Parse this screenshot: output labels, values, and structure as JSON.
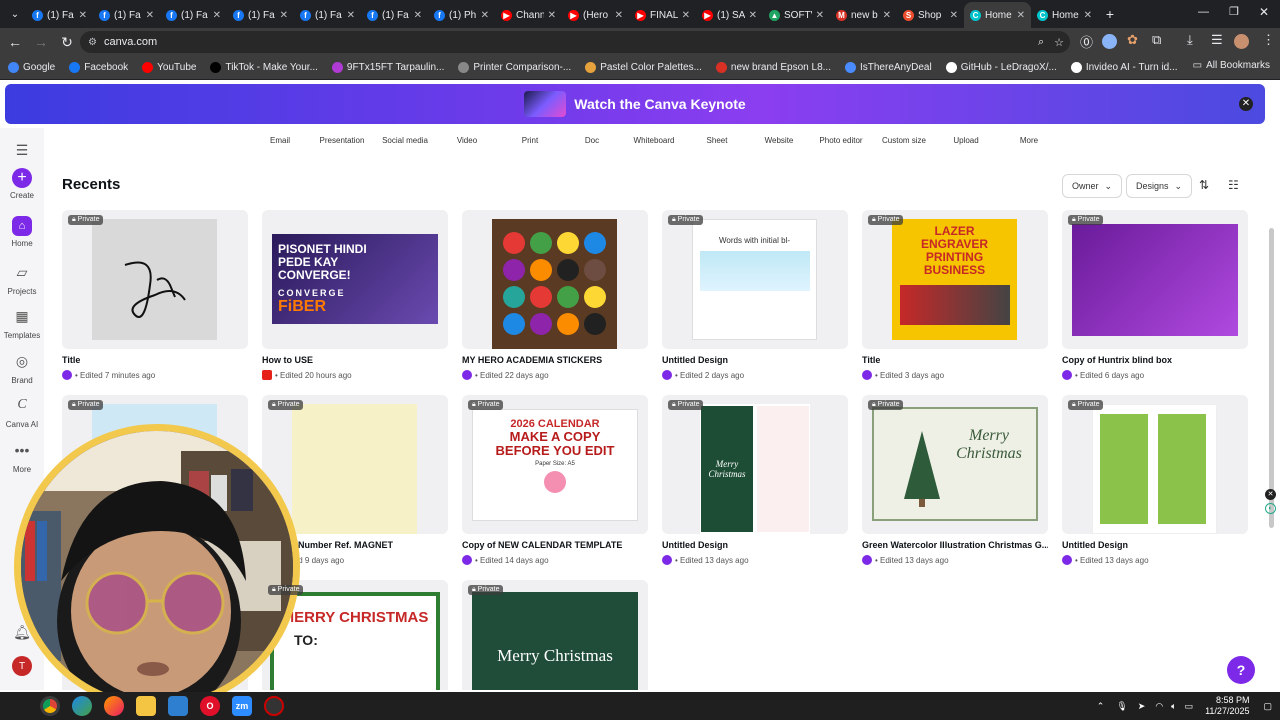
{
  "browser": {
    "tabs": [
      {
        "title": "(1) Fa",
        "icon": "facebook"
      },
      {
        "title": "(1) Fa",
        "icon": "facebook"
      },
      {
        "title": "(1) Fa",
        "icon": "facebook"
      },
      {
        "title": "(1) Fa",
        "icon": "facebook"
      },
      {
        "title": "(1) Fa",
        "icon": "facebook"
      },
      {
        "title": "(1) Fa",
        "icon": "facebook"
      },
      {
        "title": "(1) Ph",
        "icon": "facebook"
      },
      {
        "title": "Chann",
        "icon": "youtube"
      },
      {
        "title": "(Hero",
        "icon": "youtube"
      },
      {
        "title": "FINAL",
        "icon": "youtube"
      },
      {
        "title": "(1) SA",
        "icon": "youtube"
      },
      {
        "title": "SOFTV",
        "icon": "drive"
      },
      {
        "title": "new b",
        "icon": "gmail"
      },
      {
        "title": "Shop",
        "icon": "shopee"
      },
      {
        "title": "Home",
        "icon": "canva"
      },
      {
        "title": "Home",
        "icon": "canva"
      }
    ],
    "url": "canva.com",
    "bookmarks": [
      {
        "label": "Google",
        "color": "#4285f4"
      },
      {
        "label": "Facebook",
        "color": "#1877f2"
      },
      {
        "label": "YouTube",
        "color": "#ff0000"
      },
      {
        "label": "TikTok - Make Your...",
        "color": "#000000"
      },
      {
        "label": "9FTx15FT Tarpaulin...",
        "color": "#b03ad4"
      },
      {
        "label": "Printer Comparison-...",
        "color": "#888888"
      },
      {
        "label": "Pastel Color Palettes...",
        "color": "#e6a23c"
      },
      {
        "label": "new brand Epson L8...",
        "color": "#d93025"
      },
      {
        "label": "IsThereAnyDeal",
        "color": "#4a8cff"
      },
      {
        "label": "GitHub - LeDragoX/...",
        "color": "#ffffff"
      },
      {
        "label": "Invideo AI - Turn id...",
        "color": "#ffffff"
      }
    ],
    "all_bookmarks": "All Bookmarks"
  },
  "banner": {
    "text": "Watch the Canva Keynote"
  },
  "sidebar": {
    "items": [
      {
        "label": "Create"
      },
      {
        "label": "Home"
      },
      {
        "label": "Projects"
      },
      {
        "label": "Templates"
      },
      {
        "label": "Brand"
      },
      {
        "label": "Canva AI"
      },
      {
        "label": "More"
      }
    ],
    "avatar": "T"
  },
  "categories": [
    "Email",
    "Presentation",
    "Social media",
    "Video",
    "Print",
    "Doc",
    "Whiteboard",
    "Sheet",
    "Website",
    "Photo editor",
    "Custom size",
    "Upload",
    "More"
  ],
  "recents": {
    "heading": "Recents",
    "owner": "Owner",
    "type": "Designs",
    "private_label": "Private",
    "items": [
      {
        "title": "Title",
        "meta": "• Edited 7 minutes ago"
      },
      {
        "title": "How to USE",
        "meta": "• Edited 20 hours ago"
      },
      {
        "title": "MY HERO ACADEMIA STICKERS",
        "meta": "• Edited 22 days ago"
      },
      {
        "title": "Untitled Design",
        "meta": "• Edited 2 days ago"
      },
      {
        "title": "Title",
        "meta": "• Edited 3 days ago"
      },
      {
        "title": "Copy of Huntrix blind box",
        "meta": "• Edited 6 days ago"
      },
      {
        "title": "",
        "meta": ""
      },
      {
        "title": "Copy of Number Ref. MAGNET",
        "meta": "• Edited 9 days ago"
      },
      {
        "title": "Copy of NEW CALENDAR TEMPLATE",
        "meta": "• Edited 14 days ago"
      },
      {
        "title": "Untitled Design",
        "meta": "• Edited 13 days ago"
      },
      {
        "title": "Green Watercolor Illustration Christmas G...",
        "meta": "• Edited 13 days ago"
      },
      {
        "title": "Untitled Design",
        "meta": "• Edited 13 days ago"
      }
    ]
  },
  "thumb_text": {
    "pisonet": "PISONET HINDI PEDE KAY CONVERGE!",
    "converge": "CONVERGE",
    "fiber": "FiBER",
    "words": "Words with initial bl-",
    "lazer": "LAZER ENGRAVER PRINTING BUSINESS",
    "cal_year": "2026 CALENDAR",
    "cal_copy": "MAKE A COPY BEFORE YOU EDIT",
    "cal_size": "Paper Size: A5",
    "merry_christmas": "Merry Christmas",
    "merry_christmas_caps": "MERRY CHRISTMAS",
    "to": "TO:",
    "merry_christmas_to": "Merry Christmas To:"
  },
  "taskbar": {
    "time": "8:58 PM",
    "date": "11/27/2025"
  },
  "colors": {
    "canva_purple": "#7d2ae8",
    "banner_start": "#3b3ce0",
    "banner_end": "#8b3ef0"
  }
}
